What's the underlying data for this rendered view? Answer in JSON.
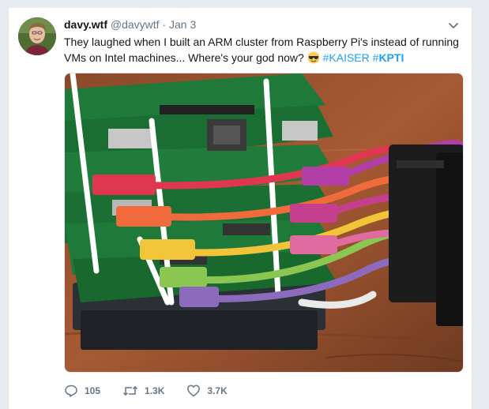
{
  "user": {
    "display_name": "davy.wtf",
    "handle": "@davywtf",
    "separator": "·",
    "timestamp": "Jan 3"
  },
  "tweet": {
    "text_before": "They laughed when I built an ARM cluster from Raspberry Pi's instead of running VMs on Intel machines... Where's your god now?",
    "emoji": "sunglasses-emoji",
    "hashtag1": "#KAISER",
    "hashtag2_prefix": "#",
    "hashtag2_bold": "KPTI"
  },
  "actions": {
    "reply_count": "105",
    "retweet_count": "1.3K",
    "like_count": "3.7K"
  },
  "icons": {
    "caret": "chevron-down-icon",
    "reply": "reply-icon",
    "retweet": "retweet-icon",
    "like": "heart-icon"
  },
  "colors": {
    "link": "#1da1f2",
    "secondary_text": "#657786",
    "primary_text": "#14171a",
    "background": "#e6ecf0"
  }
}
